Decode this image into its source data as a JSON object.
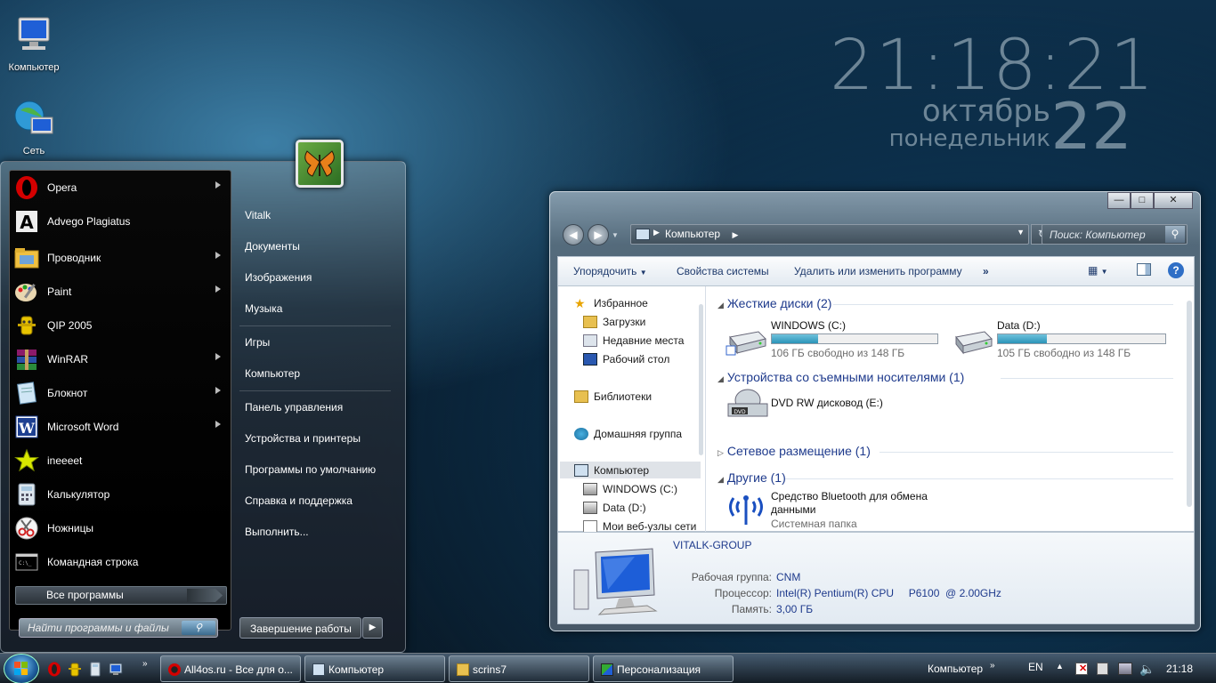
{
  "clock": {
    "time": "21:18:21",
    "month": "октябрь",
    "weekday": "понедельник",
    "day": "22"
  },
  "desktop": {
    "icons": [
      {
        "label": "Компьютер",
        "icon": "computer-icon"
      },
      {
        "label": "Сеть",
        "icon": "network-icon"
      }
    ]
  },
  "start_menu": {
    "programs": [
      {
        "label": "Opera",
        "icon": "opera-icon",
        "has_submenu": true
      },
      {
        "label": "Advego Plagiatus",
        "icon": "advego-icon",
        "has_submenu": false
      },
      {
        "label": "Проводник",
        "icon": "explorer-icon",
        "has_submenu": true
      },
      {
        "label": "Paint",
        "icon": "paint-icon",
        "has_submenu": true
      },
      {
        "label": "QIP 2005",
        "icon": "qip-icon",
        "has_submenu": false
      },
      {
        "label": "WinRAR",
        "icon": "winrar-icon",
        "has_submenu": true
      },
      {
        "label": "Блокнот",
        "icon": "notepad-icon",
        "has_submenu": true
      },
      {
        "label": "Microsoft Word",
        "icon": "word-icon",
        "has_submenu": true
      },
      {
        "label": "ineeeet",
        "icon": "star-icon",
        "has_submenu": false
      },
      {
        "label": "Калькулятор",
        "icon": "calculator-icon",
        "has_submenu": false
      },
      {
        "label": "Ножницы",
        "icon": "scissors-icon",
        "has_submenu": false
      },
      {
        "label": "Командная строка",
        "icon": "cmd-icon",
        "has_submenu": false
      }
    ],
    "all_programs": "Все программы",
    "search_placeholder": "Найти программы и файлы",
    "right": {
      "user": "Vitalk",
      "documents": "Документы",
      "images": "Изображения",
      "music": "Музыка",
      "games": "Игры",
      "computer": "Компьютер",
      "control_panel": "Панель управления",
      "devices": "Устройства и принтеры",
      "defaults": "Программы по умолчанию",
      "help": "Справка и поддержка",
      "run": "Выполнить..."
    },
    "shutdown": "Завершение работы"
  },
  "explorer": {
    "address": "Компьютер",
    "search_placeholder": "Поиск: Компьютер",
    "toolbar": {
      "organize": "Упорядочить",
      "properties": "Свойства системы",
      "uninstall": "Удалить или изменить программу",
      "more": "»"
    },
    "nav": {
      "favorites": "Избранное",
      "downloads": "Загрузки",
      "recent": "Недавние места",
      "desktop": "Рабочий стол",
      "libraries": "Библиотеки",
      "homegroup": "Домашняя группа",
      "computer": "Компьютер",
      "drive_c": "WINDOWS (C:)",
      "drive_d": "Data (D:)",
      "web": "Мои веб-узлы сети"
    },
    "groups": {
      "hdd": "Жесткие диски (2)",
      "removable": "Устройства со съемными носителями (1)",
      "network": "Сетевое размещение (1)",
      "other": "Другие (1)"
    },
    "drives": [
      {
        "name": "WINDOWS (C:)",
        "free": "106 ГБ свободно из 148 ГБ",
        "used_fraction": 0.28
      },
      {
        "name": "Data (D:)",
        "free": "105 ГБ свободно из 148 ГБ",
        "used_fraction": 0.29
      }
    ],
    "dvd": "DVD RW дисковод (E:)",
    "bluetooth": {
      "name": "Средство Bluetooth для обмена данными",
      "type": "Системная папка"
    },
    "details": {
      "name": "VITALK-GROUP",
      "workgroup_label": "Рабочая группа:",
      "workgroup": "CNM",
      "cpu_label": "Процессор:",
      "cpu": "Intel(R) Pentium(R) CPU     P6100  @ 2.00GHz",
      "memory_label": "Память:",
      "memory": "3,00 ГБ"
    }
  },
  "taskbar": {
    "buttons": [
      {
        "label": "All4os.ru - Все для о...",
        "icon": "opera-icon"
      },
      {
        "label": "Компьютер",
        "icon": "computer-icon"
      },
      {
        "label": "scrins7",
        "icon": "folder-icon"
      },
      {
        "label": "Персонализация",
        "icon": "personalize-icon"
      }
    ],
    "toolbar_label": "Компьютер",
    "language": "EN",
    "time": "21:18"
  }
}
